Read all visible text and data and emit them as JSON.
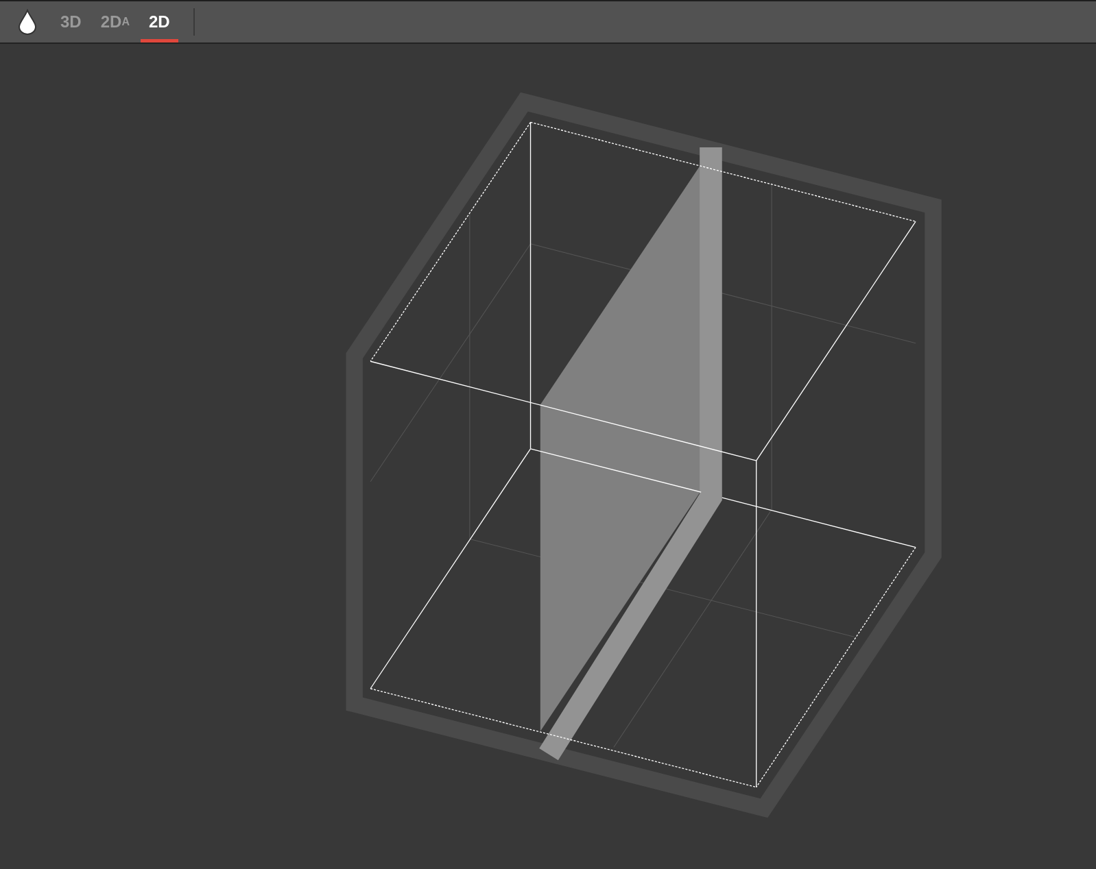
{
  "toolbar": {
    "tabs": [
      {
        "label": "3D",
        "selected": false
      },
      {
        "label": "2D",
        "suffix": "A",
        "selected": false
      },
      {
        "label": "2D",
        "selected": true
      }
    ]
  }
}
